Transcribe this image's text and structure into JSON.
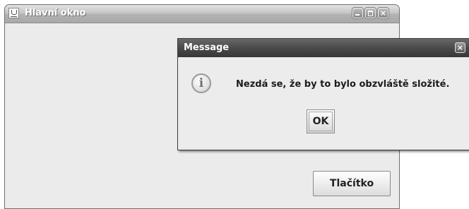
{
  "main_window": {
    "title": "Hlavní okno",
    "button_label": "Tlačítko"
  },
  "message_dialog": {
    "title": "Message",
    "text": "Nezdá se, že by to bylo obzvláště složité.",
    "ok_label": "OK",
    "icon": "information-icon"
  },
  "icons": {
    "app": "java-cup-icon",
    "minimize": "minimize-icon",
    "maximize": "maximize-icon",
    "close": "close-icon"
  },
  "colors": {
    "window_background": "#ebebeb",
    "dialog_titlebar": "#4a4a4a",
    "title_text": "#ffffff"
  }
}
